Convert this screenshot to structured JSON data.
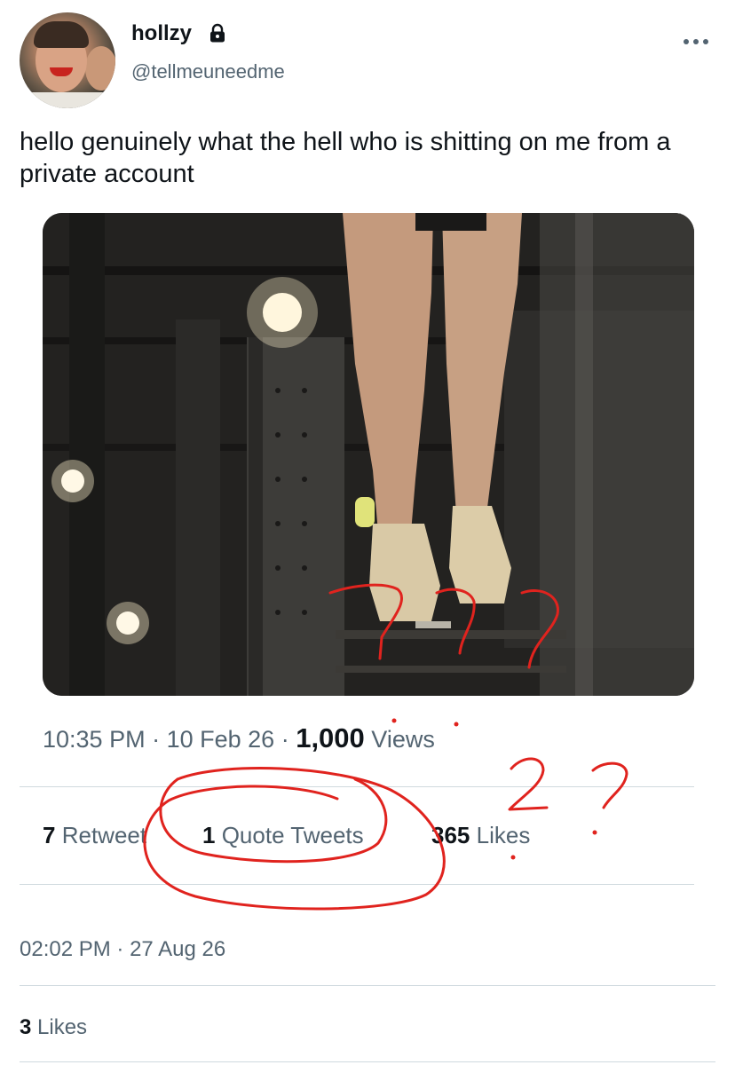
{
  "author": {
    "display_name": "hollzy",
    "handle": "@tellmeuneedme",
    "avatar_icon": "avatar",
    "lock_icon": "lock-icon",
    "more_icon": "more-icon"
  },
  "tweet": {
    "text": "hello genuinely what the hell who is shitting on me from a private account"
  },
  "meta": {
    "time": "10:35 PM",
    "date": "10 Feb 26",
    "views_count": "1,000",
    "views_label": "Views"
  },
  "stats": {
    "retweets_count": "7",
    "retweets_label": "Retweet",
    "quotes_count": "1",
    "quotes_label": "Quote Tweets",
    "likes_count": "365",
    "likes_label": "Likes"
  },
  "reply": {
    "time": "02:02 PM",
    "date": "27 Aug 26",
    "likes_count": "3",
    "likes_label": "Likes"
  },
  "annotations": {
    "on_image": "???",
    "near_views": "2 ?",
    "pen_color": "#e0231e"
  },
  "colors": {
    "text": "#0f1419",
    "secondary": "#536471",
    "divider": "#cfd9de"
  }
}
